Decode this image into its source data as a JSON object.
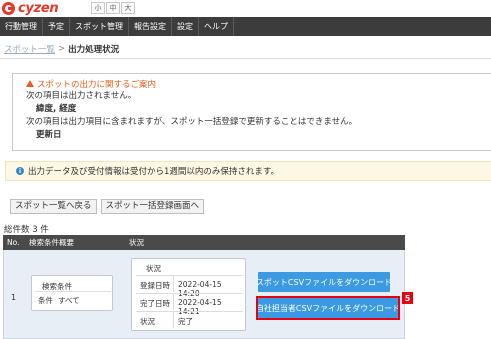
{
  "app": {
    "logo_text": "cyzen",
    "font_sizes": [
      "小",
      "中",
      "大"
    ]
  },
  "nav": [
    "行動管理",
    "予定",
    "スポット管理",
    "報告設定",
    "設定",
    "ヘルプ"
  ],
  "breadcrumb": {
    "link": "スポット一覧",
    "separator": ">",
    "current": "出力処理状況"
  },
  "notice": {
    "title": "スポットの出力に関するご案内",
    "line1": "次の項目は出力されません。",
    "item1": "緯度, 経度",
    "line2": "次の項目は出力項目に含まれますが、スポット一括登録で更新することはできません。",
    "item2": "更新日"
  },
  "info": {
    "text": "出力データ及び受付情報は受付から1週間以内のみ保持されます。"
  },
  "buttons": {
    "back_to_list": "スポット一覧へ戻る",
    "to_bulk_register": "スポット一括登録画面へ"
  },
  "total_label": "総件数 3 件",
  "table": {
    "headers": [
      "No.",
      "検索条件概要",
      "状況"
    ],
    "rows": [
      {
        "no": "1",
        "condition_title": "検索条件",
        "condition_key": "条件",
        "condition_value": "すべて",
        "status_title": "状況",
        "registered_label": "登録日時",
        "registered_value": "2022-04-15 14:20",
        "completed_label": "完了日時",
        "completed_value": "2022-04-15 14:21",
        "state_label": "状況",
        "state_value": "完了",
        "download_spot_csv": "スポットCSVファイルをダウンロード",
        "download_staff_csv": "自社担当者CSVファイルをダウンロード"
      }
    ]
  },
  "annotation_badge": "5",
  "colors": {
    "brand": "#e73828",
    "nav_bg": "#3c3c3c",
    "notice_title": "#e85d1c",
    "info_bg": "#fcf8e3",
    "download_btn": "#3b9ae1",
    "highlight": "#e60012"
  }
}
